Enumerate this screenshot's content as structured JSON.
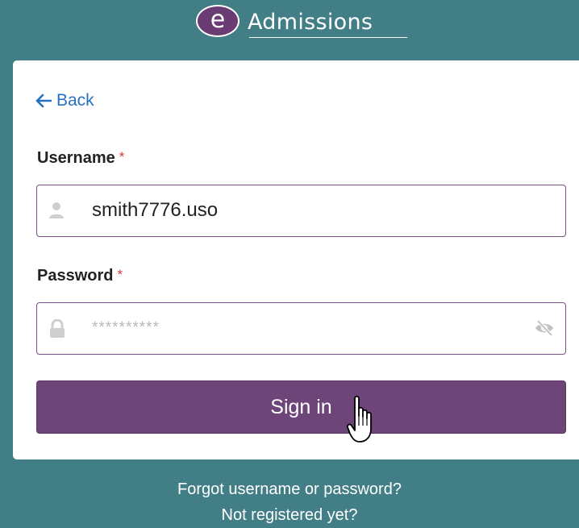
{
  "logo": {
    "badge_letter": "e",
    "wordmark": "Admissions"
  },
  "nav": {
    "back_label": "Back"
  },
  "form": {
    "username": {
      "label": "Username",
      "required_mark": "*",
      "value": "smith7776.uso"
    },
    "password": {
      "label": "Password",
      "required_mark": "*",
      "value": "**********"
    },
    "submit_label": "Sign in"
  },
  "footer": {
    "forgot_link": "Forgot username or password?",
    "register_link": "Not registered yet?"
  },
  "colors": {
    "background": "#427e86",
    "primary": "#6e4578",
    "link": "#2671c2",
    "required": "#d33a3a"
  },
  "icons": {
    "back": "arrow-left-icon",
    "username": "user-icon",
    "password": "lock-icon",
    "toggle_visibility": "eye-slash-icon",
    "cursor": "hand-pointer-icon"
  }
}
